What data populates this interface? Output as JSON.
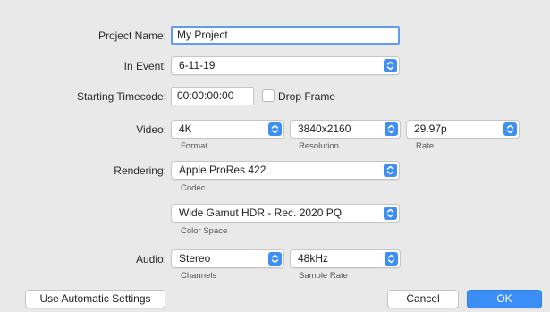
{
  "project_name": {
    "label": "Project Name:",
    "value": "My Project"
  },
  "in_event": {
    "label": "In Event:",
    "value": "6-11-19"
  },
  "starting_timecode": {
    "label": "Starting Timecode:",
    "value": "00:00:00:00",
    "drop_frame_label": "Drop Frame",
    "drop_frame_checked": false
  },
  "video": {
    "label": "Video:",
    "format": {
      "value": "4K",
      "caption": "Format"
    },
    "resolution": {
      "value": "3840x2160",
      "caption": "Resolution"
    },
    "rate": {
      "value": "29.97p",
      "caption": "Rate"
    }
  },
  "rendering": {
    "label": "Rendering:",
    "codec": {
      "value": "Apple ProRes 422",
      "caption": "Codec"
    },
    "color_space": {
      "value": "Wide Gamut HDR - Rec. 2020 PQ",
      "caption": "Color Space"
    }
  },
  "audio": {
    "label": "Audio:",
    "channels": {
      "value": "Stereo",
      "caption": "Channels"
    },
    "sample_rate": {
      "value": "48kHz",
      "caption": "Sample Rate"
    }
  },
  "buttons": {
    "automatic": "Use Automatic Settings",
    "cancel": "Cancel",
    "ok": "OK"
  },
  "colors": {
    "accent": "#3a8ef6",
    "background": "#e9e9e9",
    "focus_ring": "#5f9cf0"
  },
  "icons": {
    "popup": "updown-chevron-icon"
  }
}
